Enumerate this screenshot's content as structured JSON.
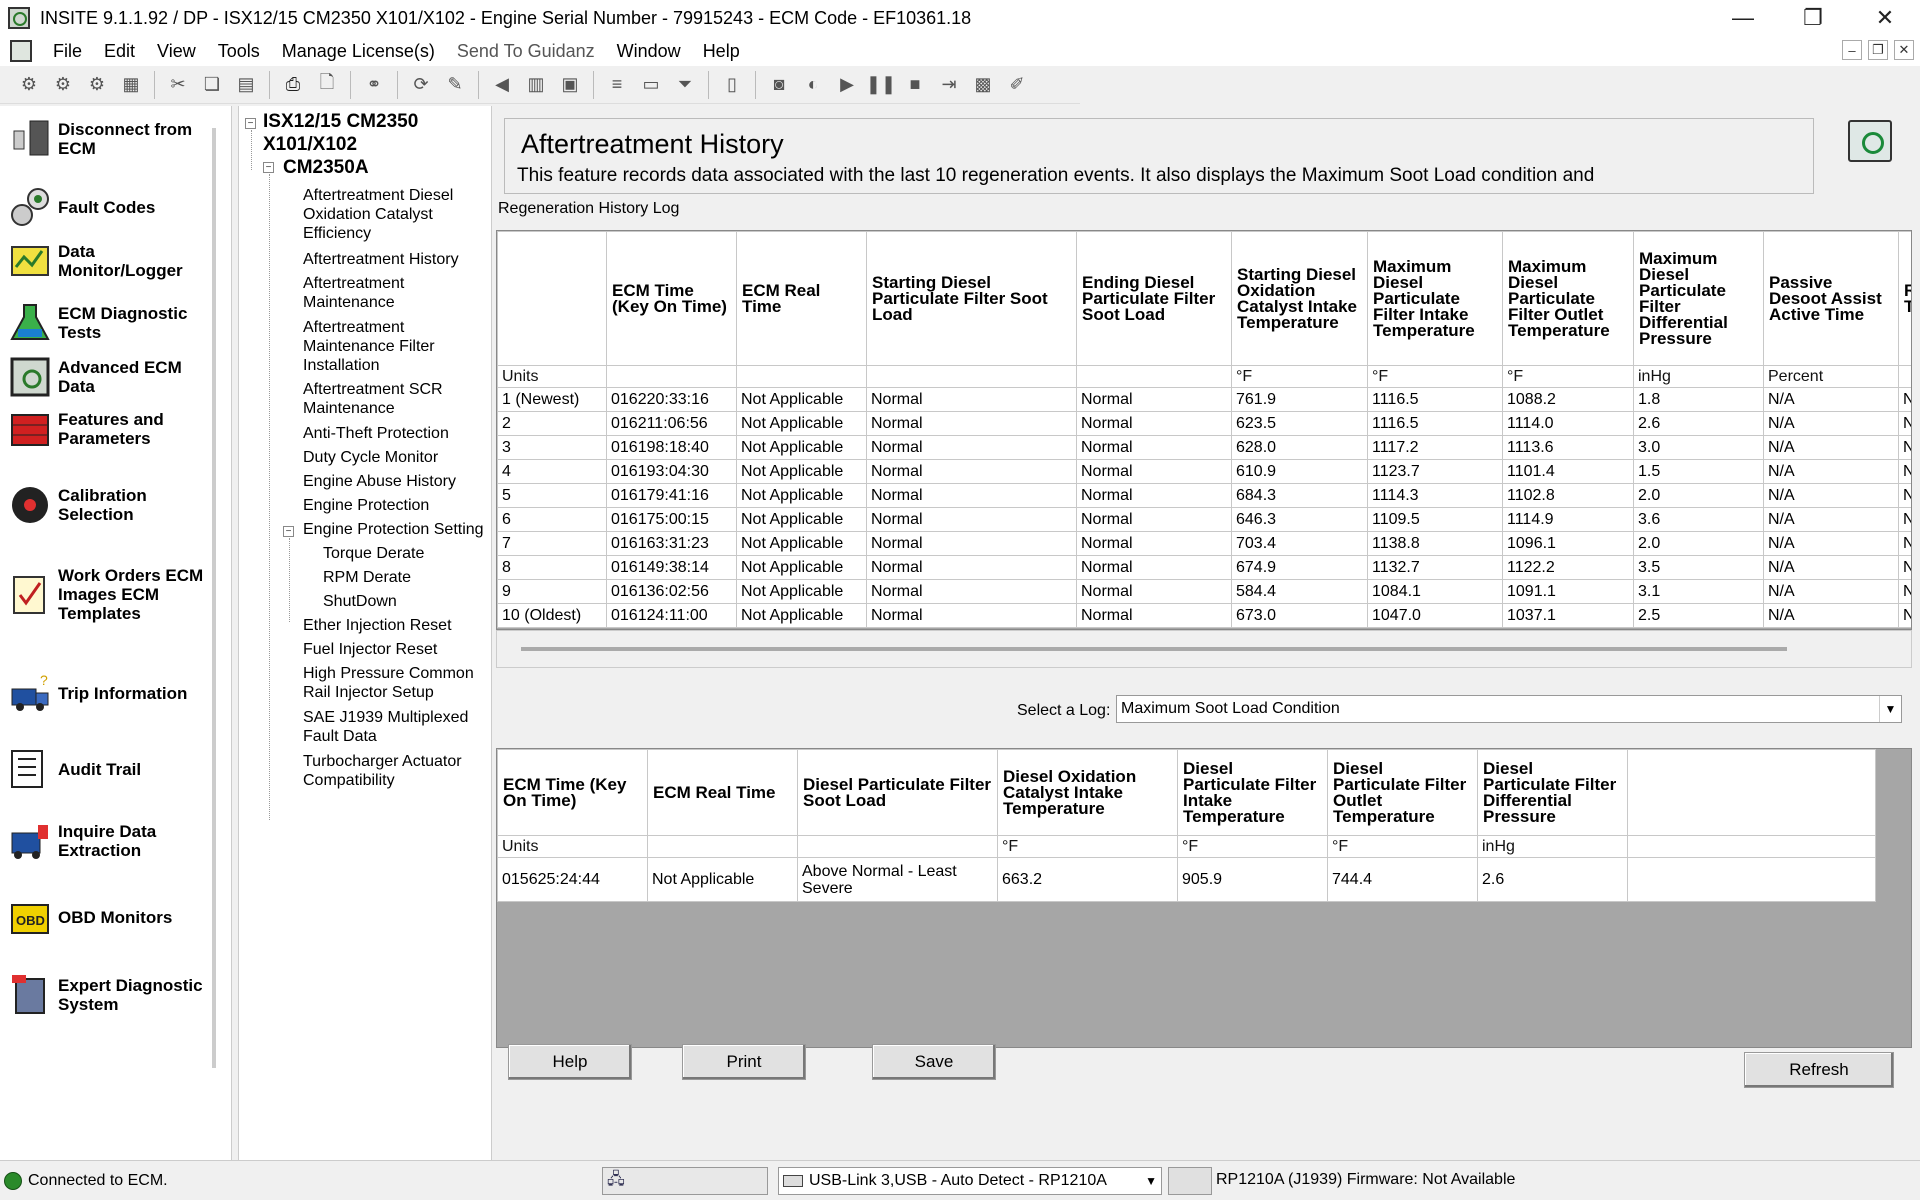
{
  "window": {
    "title": "INSITE 9.1.1.92  / DP - ISX12/15 CM2350 X101/X102 - Engine Serial Number - 79915243 - ECM Code - EF10361.18"
  },
  "menu": [
    "File",
    "Edit",
    "View",
    "Tools",
    "Manage License(s)",
    "Send To Guidanz",
    "Window",
    "Help"
  ],
  "left_panel": [
    {
      "label": "Disconnect from ECM",
      "icon": "disconnect-icon"
    },
    {
      "label": "Fault Codes",
      "icon": "fault-codes-icon"
    },
    {
      "label": "Data Monitor/Logger",
      "icon": "data-monitor-icon"
    },
    {
      "label": "ECM Diagnostic Tests",
      "icon": "diagnostic-flask-icon"
    },
    {
      "label": "Advanced ECM Data",
      "icon": "advanced-ecm-icon"
    },
    {
      "label": "Features and Parameters",
      "icon": "toolbox-icon"
    },
    {
      "label": "Calibration Selection",
      "icon": "calibration-disc-icon"
    },
    {
      "label": "Work Orders ECM Images ECM Templates",
      "icon": "work-orders-icon"
    },
    {
      "label": "Trip Information",
      "icon": "truck-icon"
    },
    {
      "label": "Audit Trail",
      "icon": "audit-trail-icon"
    },
    {
      "label": "Inquire Data Extraction",
      "icon": "inquire-icon"
    },
    {
      "label": "OBD Monitors",
      "icon": "obd-icon"
    },
    {
      "label": "Expert Diagnostic System",
      "icon": "expert-diagnostic-icon"
    }
  ],
  "tree": {
    "root": "ISX12/15 CM2350 X101/X102",
    "child": "CM2350A",
    "items": [
      "Aftertreatment Diesel Oxidation Catalyst Efficiency",
      "Aftertreatment History",
      "Aftertreatment Maintenance",
      "Aftertreatment Maintenance Filter Installation",
      "Aftertreatment SCR Maintenance",
      "Anti-Theft Protection",
      "Duty Cycle Monitor",
      "Engine Abuse History",
      "Engine Protection",
      "Engine Protection Setting",
      "Torque Derate",
      "RPM Derate",
      "ShutDown",
      "Ether Injection Reset",
      "Fuel Injector Reset",
      "High Pressure Common Rail Injector Setup",
      "SAE J1939 Multiplexed Fault Data",
      "Turbocharger Actuator Compatibility"
    ]
  },
  "header": {
    "title": "Aftertreatment History",
    "description": "This feature records data associated with the last 10 regeneration events. It also displays the Maximum Soot Load condition and"
  },
  "regen_log": {
    "label": "Regeneration History Log",
    "columns": [
      "",
      "ECM Time (Key On Time)",
      "ECM Real Time",
      "Starting Diesel Particulate Filter Soot Load",
      "Ending Diesel Particulate Filter Soot Load",
      "Starting Diesel Oxidation Catalyst Intake Temperature",
      "Maximum Diesel Particulate Filter Intake Temperature",
      "Maximum Diesel Particulate Filter Outlet Temperature",
      "Maximum Diesel Particulate Filter Differential Pressure",
      "Passive Desoot Assist Active Time",
      "Re Ti"
    ],
    "units": [
      "Units",
      "",
      "",
      "",
      "",
      "°F",
      "°F",
      "°F",
      "inHg",
      "Percent",
      ""
    ],
    "rows": [
      [
        "1 (Newest)",
        "016220:33:16",
        "Not Applicable",
        "Normal",
        "Normal",
        "761.9",
        "1116.5",
        "1088.2",
        "1.8",
        "N/A",
        "N/"
      ],
      [
        "2",
        "016211:06:56",
        "Not Applicable",
        "Normal",
        "Normal",
        "623.5",
        "1116.5",
        "1114.0",
        "2.6",
        "N/A",
        "N/"
      ],
      [
        "3",
        "016198:18:40",
        "Not Applicable",
        "Normal",
        "Normal",
        "628.0",
        "1117.2",
        "1113.6",
        "3.0",
        "N/A",
        "N/"
      ],
      [
        "4",
        "016193:04:30",
        "Not Applicable",
        "Normal",
        "Normal",
        "610.9",
        "1123.7",
        "1101.4",
        "1.5",
        "N/A",
        "N/"
      ],
      [
        "5",
        "016179:41:16",
        "Not Applicable",
        "Normal",
        "Normal",
        "684.3",
        "1114.3",
        "1102.8",
        "2.0",
        "N/A",
        "N/"
      ],
      [
        "6",
        "016175:00:15",
        "Not Applicable",
        "Normal",
        "Normal",
        "646.3",
        "1109.5",
        "1114.9",
        "3.6",
        "N/A",
        "N/"
      ],
      [
        "7",
        "016163:31:23",
        "Not Applicable",
        "Normal",
        "Normal",
        "703.4",
        "1138.8",
        "1096.1",
        "2.0",
        "N/A",
        "N/"
      ],
      [
        "8",
        "016149:38:14",
        "Not Applicable",
        "Normal",
        "Normal",
        "674.9",
        "1132.7",
        "1122.2",
        "3.5",
        "N/A",
        "N/"
      ],
      [
        "9",
        "016136:02:56",
        "Not Applicable",
        "Normal",
        "Normal",
        "584.4",
        "1084.1",
        "1091.1",
        "3.1",
        "N/A",
        "N/"
      ],
      [
        "10 (Oldest)",
        "016124:11:00",
        "Not Applicable",
        "Normal",
        "Normal",
        "673.0",
        "1047.0",
        "1037.1",
        "2.5",
        "N/A",
        "N/"
      ]
    ]
  },
  "select_log": {
    "label": "Select a Log:",
    "value": "Maximum Soot Load Condition"
  },
  "soot_table": {
    "columns": [
      "ECM Time (Key On Time)",
      "ECM Real Time",
      "Diesel Particulate Filter Soot Load",
      "Diesel Oxidation Catalyst Intake Temperature",
      "Diesel Particulate Filter Intake Temperature",
      "Diesel Particulate Filter Outlet Temperature",
      "Diesel Particulate Filter Differential Pressure",
      ""
    ],
    "units": [
      "Units",
      "",
      "",
      "°F",
      "°F",
      "°F",
      "inHg",
      ""
    ],
    "rows": [
      [
        "015625:24:44",
        "Not Applicable",
        "Above Normal - Least Severe",
        "663.2",
        "905.9",
        "744.4",
        "2.6",
        ""
      ]
    ]
  },
  "buttons": {
    "help": "Help",
    "print": "Print",
    "save": "Save",
    "refresh": "Refresh"
  },
  "status": {
    "connection": "Connected to ECM.",
    "adapter": "USB-Link 3,USB - Auto Detect - RP1210A",
    "firmware": "RP1210A (J1939)  Firmware: Not Available"
  }
}
